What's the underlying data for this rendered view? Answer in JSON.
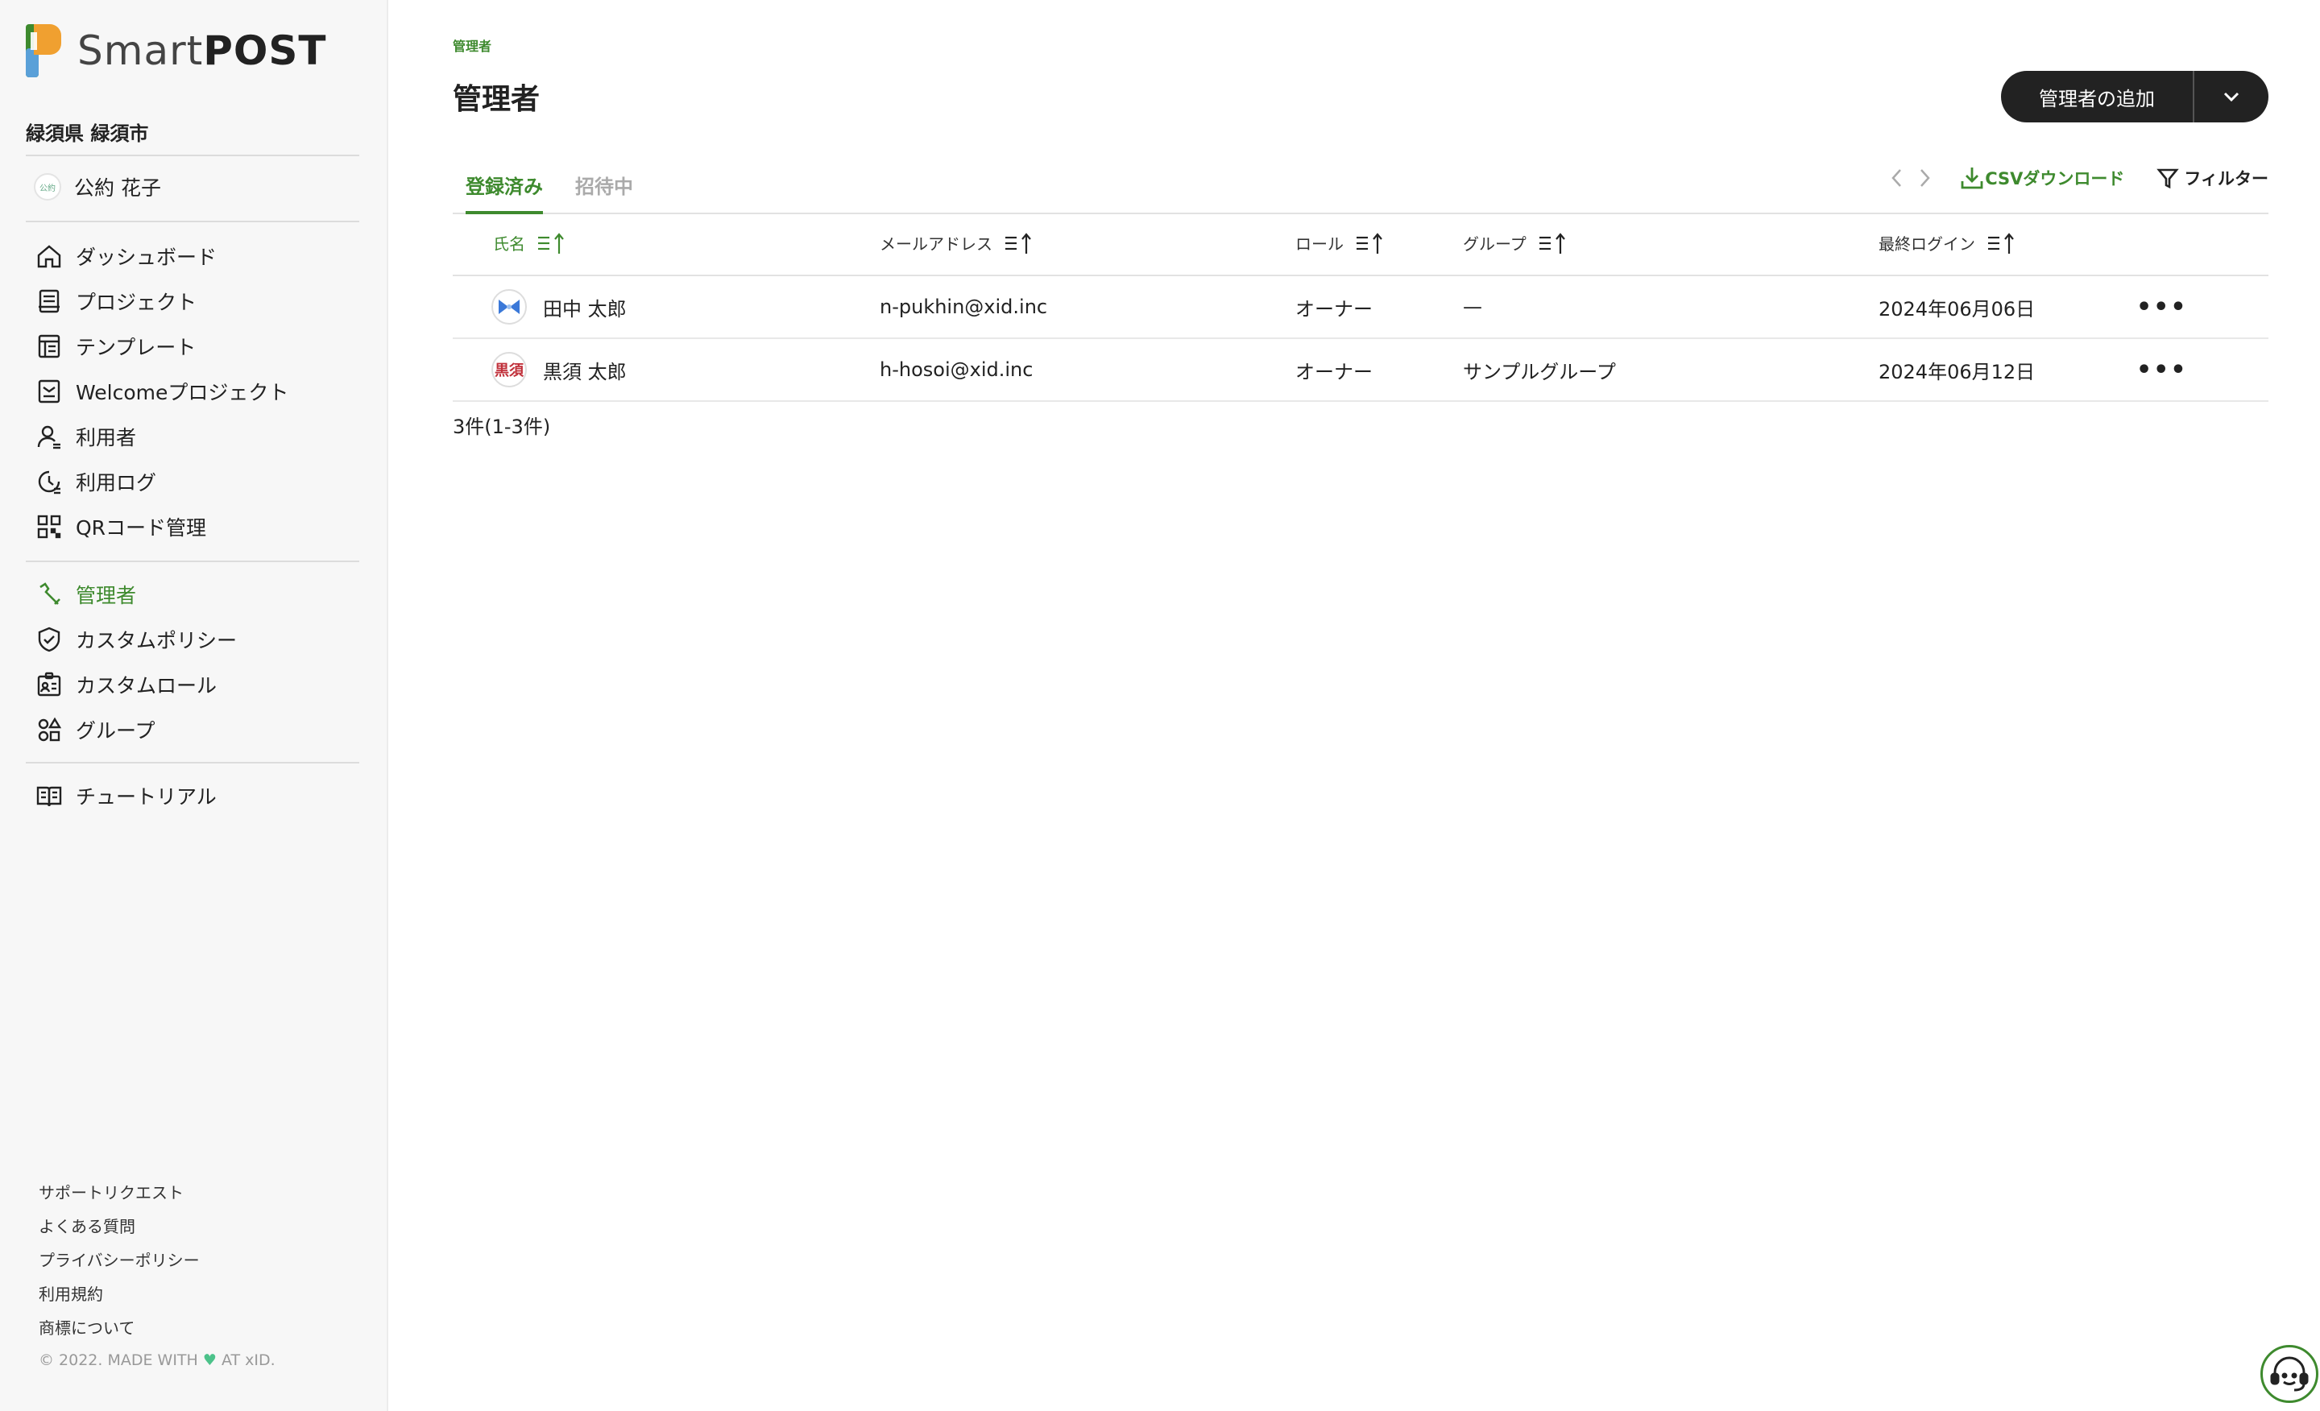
{
  "app": {
    "name_light": "Smart",
    "name_bold": "POST",
    "org": "緑須県 緑須市"
  },
  "user": {
    "avatar_text": "公約",
    "name": "公約 花子"
  },
  "nav_main": [
    {
      "label": "ダッシュボード",
      "icon": "home-icon"
    },
    {
      "label": "プロジェクト",
      "icon": "project-icon"
    },
    {
      "label": "テンプレート",
      "icon": "template-icon"
    },
    {
      "label": "Welcomeプロジェクト",
      "icon": "welcome-icon"
    },
    {
      "label": "利用者",
      "icon": "user-icon"
    },
    {
      "label": "利用ログ",
      "icon": "clock-icon"
    },
    {
      "label": "QRコード管理",
      "icon": "qr-icon"
    }
  ],
  "nav_admin": [
    {
      "label": "管理者",
      "icon": "wrench-icon",
      "active": true
    },
    {
      "label": "カスタムポリシー",
      "icon": "shield-icon"
    },
    {
      "label": "カスタムロール",
      "icon": "id-card-icon"
    },
    {
      "label": "グループ",
      "icon": "shapes-icon"
    }
  ],
  "nav_help": [
    {
      "label": "チュートリアル",
      "icon": "book-icon"
    }
  ],
  "footer": {
    "links": [
      "サポートリクエスト",
      "よくある質問",
      "プライバシーポリシー",
      "利用規約",
      "商標について"
    ],
    "copyright_pre": "© 2022. MADE WITH",
    "copyright_post": "AT xID."
  },
  "page": {
    "breadcrumb": "管理者",
    "title": "管理者",
    "add_button": "管理者の追加"
  },
  "tabs": [
    {
      "label": "登録済み",
      "active": true
    },
    {
      "label": "招待中",
      "active": false
    }
  ],
  "toolbar": {
    "csv": "CSVダウンロード",
    "filter": "フィルター"
  },
  "table": {
    "headers": [
      "氏名",
      "メールアドレス",
      "ロール",
      "グループ",
      "最終ログイン"
    ],
    "rows": [
      {
        "avatar": "",
        "name": "田中 太郎",
        "email": "n-pukhin@xid.inc",
        "role": "オーナー",
        "group": "—",
        "last_login": "2024年06月06日"
      },
      {
        "avatar": "黒須",
        "name": "黒須 太郎",
        "email": "h-hosoi@xid.inc",
        "role": "オーナー",
        "group": "サンプルグループ",
        "last_login": "2024年06月12日"
      }
    ]
  },
  "count": "3件(1-3件)",
  "colors": {
    "accent": "#3e8a2e",
    "dark_button": "#222222"
  }
}
